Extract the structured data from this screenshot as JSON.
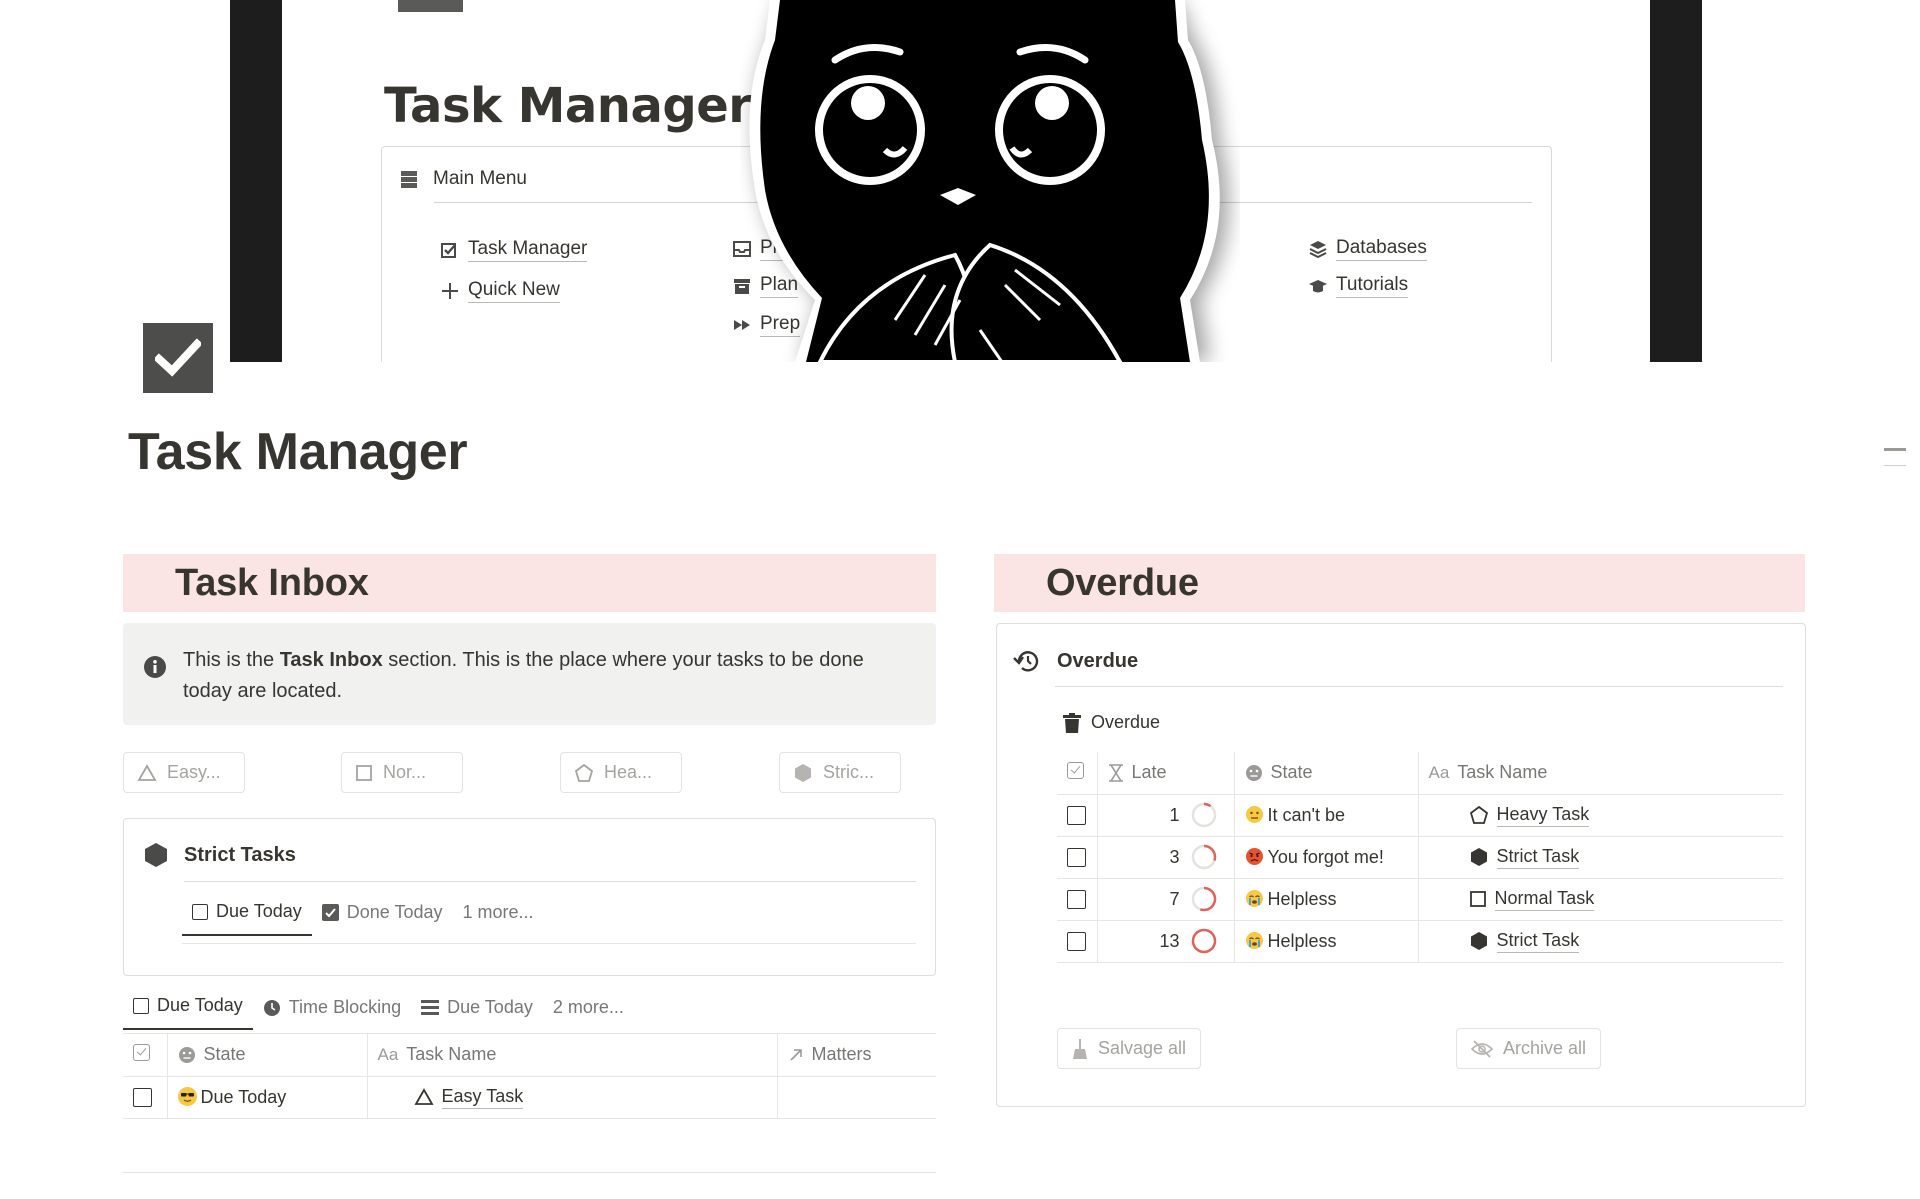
{
  "cover": {
    "title": "Task Manager",
    "menu_title": "Main Menu",
    "links": {
      "task_manager": "Task Manager",
      "quick_new": "Quick New",
      "proc": "Proc",
      "plan": "Plan",
      "prep": "Prep",
      "databases": "Databases",
      "tutorials": "Tutorials"
    }
  },
  "page": {
    "title": "Task Manager"
  },
  "inbox": {
    "heading": "Task Inbox",
    "callout_pre": "This is the ",
    "callout_bold": "Task Inbox",
    "callout_post": " section. This is the place where your tasks to be done today are located.",
    "filters": [
      "Easy...",
      "Nor...",
      "Hea...",
      "Stric..."
    ],
    "card_title": "Strict Tasks",
    "card_tabs": [
      "Due Today",
      "Done Today",
      "1 more..."
    ],
    "view_tabs": [
      "Due Today",
      "Time Blocking",
      "Due Today",
      "2 more..."
    ],
    "table": {
      "headers": [
        "State",
        "Task Name",
        "Matters"
      ],
      "rows": [
        {
          "state": "Due Today",
          "task": "Easy Task",
          "matters": ""
        }
      ]
    }
  },
  "overdue": {
    "heading": "Overdue",
    "card_title": "Overdue",
    "sub_title": "Overdue",
    "table": {
      "headers": [
        "Late",
        "State",
        "Task Name"
      ],
      "rows": [
        {
          "late": "1",
          "state": "It can't be",
          "task": "Heavy Task",
          "task_icon": "pentagon-icon",
          "progress": 0.1
        },
        {
          "late": "3",
          "state": "You forgot me!",
          "task": "Strict Task",
          "task_icon": "hexagon-icon",
          "progress": 0.3
        },
        {
          "late": "7",
          "state": "Helpless",
          "task": "Normal Task",
          "task_icon": "square-icon",
          "progress": 0.55
        },
        {
          "late": "13",
          "state": "Helpless",
          "task": "Strict Task",
          "task_icon": "hexagon-icon",
          "progress": 1.0
        }
      ]
    },
    "buttons": {
      "salvage": "Salvage all",
      "archive": "Archive all"
    }
  },
  "colors": {
    "section_bg": "#fbe4e4",
    "callout_bg": "#f1f1ef",
    "text": "#37352f",
    "muted": "#787774",
    "ring": "#e16259"
  }
}
